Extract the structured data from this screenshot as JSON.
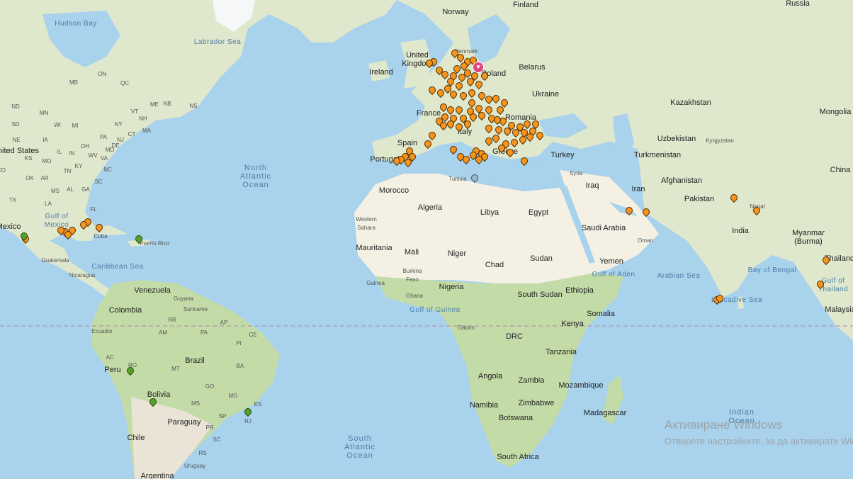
{
  "colors": {
    "water": "#a9d2ec",
    "land": "#e9e4d6",
    "forest": "#b7d49a",
    "desert": "#f4f1e4",
    "ice": "#f5f7f9",
    "marker_orange": "#f7941d",
    "marker_green": "#5aa02c",
    "marker_gray": "#9fb7c9",
    "marker_pink": "#e0457b"
  },
  "labels": {
    "greenland_bay": "Hudson Bay",
    "labrador_sea": "Labrador Sea",
    "norway": "Norway",
    "finland": "Finland",
    "russia": "Russia",
    "ireland": "Ireland",
    "uk": "United\nKingdom",
    "denmark": "Denmark",
    "poland": "Poland",
    "belarus": "Belarus",
    "ukraine": "Ukraine",
    "kazakhstan": "Kazakhstan",
    "mongolia": "Mongolia",
    "france": "France",
    "romania": "Romania",
    "uzbekistan": "Uzbekistan",
    "kyrgyzstan": "Kyrgyzstan",
    "spain": "Spain",
    "portugal": "Portugal",
    "italy": "Italy",
    "greece": "Greece",
    "turkey": "Turkey",
    "turkmenistan": "Turkmenistan",
    "syria": "Syria",
    "iraq": "Iraq",
    "iran": "Iran",
    "afghanistan": "Afghanistan",
    "china": "China",
    "tunisia": "Tunisia",
    "morocco": "Morocco",
    "algeria": "Algeria",
    "libya": "Libya",
    "egypt": "Egypt",
    "pakistan": "Pakistan",
    "nepal": "Nepal",
    "india": "India",
    "western_sahara": "Western\nSahara",
    "saudi": "Saudi Arabia",
    "oman": "Oman",
    "yemen": "Yemen",
    "myanmar": "Myanmar\n(Burma)",
    "thailand": "Thailand",
    "mauritania": "Mauritania",
    "mali": "Mali",
    "niger": "Niger",
    "chad": "Chad",
    "sudan": "Sudan",
    "burkina": "Burkina\nFaso",
    "guinea": "Guinea",
    "ghana": "Ghana",
    "nigeria": "Nigeria",
    "south_sudan": "South Sudan",
    "ethiopia": "Ethiopia",
    "somalia": "Somalia",
    "gabon": "Gabon",
    "kenya": "Kenya",
    "drc": "DRC",
    "tanzania": "Tanzania",
    "angola": "Angola",
    "zambia": "Zambia",
    "mozambique": "Mozambique",
    "namibia": "Namibia",
    "zimbabwe": "Zimbabwe",
    "botswana": "Botswana",
    "madagascar": "Madagascar",
    "south_africa": "South Africa",
    "malaysia": "Malaysia",
    "united_states": "United States",
    "mexico": "Mexico",
    "cuba": "Cuba",
    "puerto_rico": "Puerto Rico",
    "guatemala": "Guatemala",
    "nicaragua": "Nicaragua",
    "venezuela": "Venezuela",
    "colombia": "Colombia",
    "guyana": "Guyana",
    "suriname": "Suriname",
    "ecuador": "Ecuador",
    "peru": "Peru",
    "brazil": "Brazil",
    "bolivia": "Bolivia",
    "paraguay": "Paraguay",
    "chile": "Chile",
    "uruguay": "Uruguay",
    "argentina": "Argentina",
    "gulf_mexico": "Gulf of\nMexico",
    "caribbean": "Caribbean Sea",
    "gulf_guinea": "Gulf of Guinea",
    "gulf_aden": "Gulf of Aden",
    "arabian_sea": "Arabian Sea",
    "bay_bengal": "Bay of Bengal",
    "laccadive": "Laccadive Sea",
    "gulf_thailand": "Gulf of\nThailand",
    "north_atlantic": "North\nAtlantic\nOcean",
    "south_atlantic": "South\nAtlantic\nOcean",
    "indian_ocean": "Indian\nOcean"
  },
  "state_codes": [
    "MB",
    "ON",
    "QC",
    "NB",
    "NS",
    "ND",
    "MN",
    "WI",
    "MI",
    "SD",
    "IA",
    "IL",
    "IN",
    "OH",
    "PA",
    "NY",
    "VT",
    "NH",
    "ME",
    "MA",
    "CT",
    "NE",
    "KS",
    "MO",
    "KY",
    "WV",
    "VA",
    "MD",
    "DE",
    "NJ",
    "OK",
    "AR",
    "TN",
    "NC",
    "SC",
    "MS",
    "AL",
    "GA",
    "TX",
    "LA",
    "FL",
    "CO",
    "AC",
    "RO",
    "MT",
    "PA",
    "PI",
    "CE",
    "BA",
    "GO",
    "MG",
    "ES",
    "RJ",
    "MS",
    "SP",
    "PR",
    "SC",
    "RS",
    "AM",
    "RR",
    "AP"
  ],
  "watermark": {
    "title": "Активиране Windows",
    "subtitle": "Отворете настройките, за да активирате Windows."
  }
}
